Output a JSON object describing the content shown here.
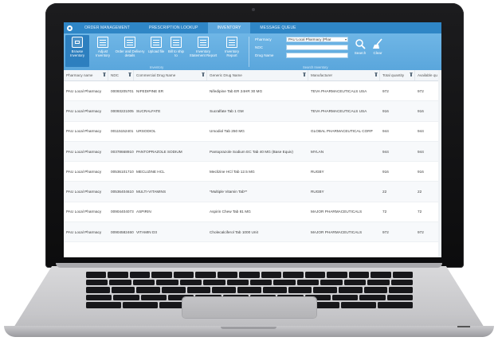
{
  "nav": {
    "tabs": [
      {
        "label": "ORDER MANAGEMENT"
      },
      {
        "label": "PRESCRIPTION LOOKUP"
      },
      {
        "label": "INVENTORY"
      },
      {
        "label": "MESSAGE QUEUE"
      }
    ],
    "active_tab": "INVENTORY"
  },
  "ribbon": {
    "buttons": [
      {
        "label": "Browse Inventory",
        "icon": "browse-icon"
      },
      {
        "label": "Adjust Inventory",
        "icon": "adjust-icon"
      },
      {
        "label": "Order and Delivery details",
        "icon": "order-details-icon"
      },
      {
        "label": "Upload file",
        "icon": "upload-icon"
      },
      {
        "label": "Bill to ship to",
        "icon": "bill-ship-icon"
      },
      {
        "label": "Inventory Statement Report",
        "icon": "report-icon"
      },
      {
        "label": "Inventory Report",
        "icon": "report-icon"
      }
    ],
    "group_label": "Inventory",
    "search": {
      "pharmacy_label": "Pharmacy",
      "pharmacy_value": "PAU Local Pharmacy (Phar",
      "ndc_label": "NDC",
      "drug_name_label": "Drug Name",
      "search_label": "Search",
      "clear_label": "Clear",
      "group_label": "Search Inventory"
    }
  },
  "grid": {
    "columns": [
      "Pharmacy name",
      "NDC",
      "Commercial Drug Name",
      "Generic Drug Name",
      "Manufacturer",
      "Total quantity",
      "Available qu"
    ],
    "rows": [
      [
        "PAU Local Pharmacy",
        "00093205701",
        "NIFEDIPINE ER",
        "Nifedipine Tab ER 24HR 30 MG",
        "TEVA PHARMACEUTICALS USA",
        "972",
        "972"
      ],
      [
        "PAU Local Pharmacy",
        "00093221005",
        "SUCRALFATE",
        "Sucralfate Tab 1 GM",
        "TEVA PHARMACEUTICALS USA",
        "916",
        "916"
      ],
      [
        "PAU Local Pharmacy",
        "00115152401",
        "URSODIOL",
        "Ursodiol Tab 250 MG",
        "GLOBAL PHARMACEUTICAL CORP",
        "944",
        "944"
      ],
      [
        "PAU Local Pharmacy",
        "00378668910",
        "PANTOPRAZOLE SODIUM",
        "Pantoprazole Sodium EC Tab 40 MG (Base Equiv)",
        "MYLAN",
        "944",
        "944"
      ],
      [
        "PAU Local Pharmacy",
        "00536101710",
        "MECLIZINE HCL",
        "Meclizine HCl Tab 12.5 MG",
        "RUGBY",
        "916",
        "916"
      ],
      [
        "PAU Local Pharmacy",
        "00536404610",
        "MULTI-VITAMINS",
        "*Multiple Vitamin Tab**",
        "RUGBY",
        "22",
        "22"
      ],
      [
        "PAU Local Pharmacy",
        "00904404073",
        "ASPIRIN",
        "Aspirin Chew Tab 81 MG",
        "MAJOR PHARMACEUTICALS",
        "72",
        "72"
      ],
      [
        "PAU Local Pharmacy",
        "00904582460",
        "VITAMIN D3",
        "Cholecalciferol Tab 1000 Unit",
        "MAJOR PHARMACEUTICALS",
        "972",
        "972"
      ]
    ]
  },
  "colors": {
    "nav_bar": "#2f86c6",
    "ribbon": "#5aa6dc",
    "active_button": "#2d7fbf"
  }
}
